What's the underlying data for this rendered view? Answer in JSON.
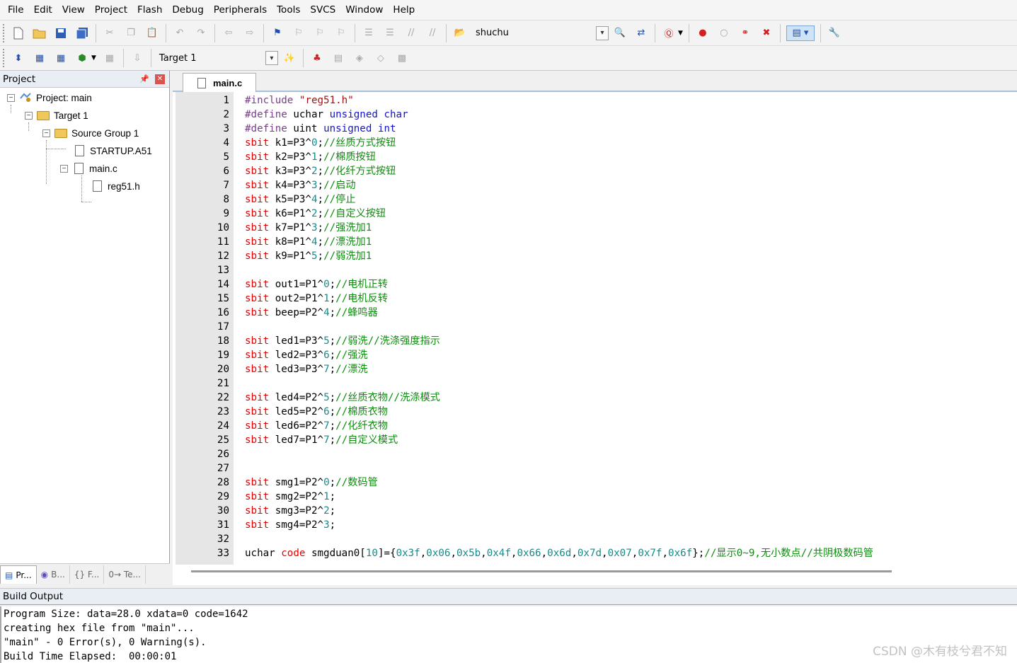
{
  "menu": [
    "File",
    "Edit",
    "View",
    "Project",
    "Flash",
    "Debug",
    "Peripherals",
    "Tools",
    "SVCS",
    "Window",
    "Help"
  ],
  "toolbar1": {
    "find_combo_value": "shuchu"
  },
  "toolbar2": {
    "target_combo_value": "Target 1"
  },
  "project_panel": {
    "title": "Project",
    "tree": [
      {
        "label": "Project: main",
        "level": 0,
        "kind": "project"
      },
      {
        "label": "Target 1",
        "level": 1,
        "kind": "target"
      },
      {
        "label": "Source Group 1",
        "level": 2,
        "kind": "folder"
      },
      {
        "label": "STARTUP.A51",
        "level": 3,
        "kind": "file"
      },
      {
        "label": "main.c",
        "level": 3,
        "kind": "file"
      },
      {
        "label": "reg51.h",
        "level": 4,
        "kind": "file"
      }
    ],
    "tabs": [
      "Pr...",
      "B...",
      "{} F...",
      "0→ Te..."
    ]
  },
  "editor": {
    "tab_label": "main.c",
    "lines": [
      [
        {
          "t": "#include ",
          "c": "pp"
        },
        {
          "t": "\"reg51.h\"",
          "c": "str"
        }
      ],
      [
        {
          "t": "#define ",
          "c": "pp"
        },
        {
          "t": "uchar ",
          "c": ""
        },
        {
          "t": "unsigned char",
          "c": "kw"
        }
      ],
      [
        {
          "t": "#define ",
          "c": "pp"
        },
        {
          "t": "uint ",
          "c": ""
        },
        {
          "t": "unsigned int",
          "c": "kw"
        }
      ],
      [
        {
          "t": "sbit ",
          "c": "red"
        },
        {
          "t": "k1=P3^",
          "c": ""
        },
        {
          "t": "0",
          "c": "num"
        },
        {
          "t": ";",
          "c": ""
        },
        {
          "t": "//丝质方式按钮",
          "c": "cm"
        }
      ],
      [
        {
          "t": "sbit ",
          "c": "red"
        },
        {
          "t": "k2=P3^",
          "c": ""
        },
        {
          "t": "1",
          "c": "num"
        },
        {
          "t": ";",
          "c": ""
        },
        {
          "t": "//棉质按钮",
          "c": "cm"
        }
      ],
      [
        {
          "t": "sbit ",
          "c": "red"
        },
        {
          "t": "k3=P3^",
          "c": ""
        },
        {
          "t": "2",
          "c": "num"
        },
        {
          "t": ";",
          "c": ""
        },
        {
          "t": "//化纤方式按钮",
          "c": "cm"
        }
      ],
      [
        {
          "t": "sbit ",
          "c": "red"
        },
        {
          "t": "k4=P3^",
          "c": ""
        },
        {
          "t": "3",
          "c": "num"
        },
        {
          "t": ";",
          "c": ""
        },
        {
          "t": "//启动",
          "c": "cm"
        }
      ],
      [
        {
          "t": "sbit ",
          "c": "red"
        },
        {
          "t": "k5=P3^",
          "c": ""
        },
        {
          "t": "4",
          "c": "num"
        },
        {
          "t": ";",
          "c": ""
        },
        {
          "t": "//停止",
          "c": "cm"
        }
      ],
      [
        {
          "t": "sbit ",
          "c": "red"
        },
        {
          "t": "k6=P1^",
          "c": ""
        },
        {
          "t": "2",
          "c": "num"
        },
        {
          "t": ";",
          "c": ""
        },
        {
          "t": "//自定义按钮",
          "c": "cm"
        }
      ],
      [
        {
          "t": "sbit ",
          "c": "red"
        },
        {
          "t": "k7=P1^",
          "c": ""
        },
        {
          "t": "3",
          "c": "num"
        },
        {
          "t": ";",
          "c": ""
        },
        {
          "t": "//强洗加1",
          "c": "cm"
        }
      ],
      [
        {
          "t": "sbit ",
          "c": "red"
        },
        {
          "t": "k8=P1^",
          "c": ""
        },
        {
          "t": "4",
          "c": "num"
        },
        {
          "t": ";",
          "c": ""
        },
        {
          "t": "//漂洗加1",
          "c": "cm"
        }
      ],
      [
        {
          "t": "sbit ",
          "c": "red"
        },
        {
          "t": "k9=P1^",
          "c": ""
        },
        {
          "t": "5",
          "c": "num"
        },
        {
          "t": ";",
          "c": ""
        },
        {
          "t": "//弱洗加1",
          "c": "cm"
        }
      ],
      [],
      [
        {
          "t": "sbit ",
          "c": "red"
        },
        {
          "t": "out1=P1^",
          "c": ""
        },
        {
          "t": "0",
          "c": "num"
        },
        {
          "t": ";",
          "c": ""
        },
        {
          "t": "//电机正转",
          "c": "cm"
        }
      ],
      [
        {
          "t": "sbit ",
          "c": "red"
        },
        {
          "t": "out2=P1^",
          "c": ""
        },
        {
          "t": "1",
          "c": "num"
        },
        {
          "t": ";",
          "c": ""
        },
        {
          "t": "//电机反转",
          "c": "cm"
        }
      ],
      [
        {
          "t": "sbit ",
          "c": "red"
        },
        {
          "t": "beep=P2^",
          "c": ""
        },
        {
          "t": "4",
          "c": "num"
        },
        {
          "t": ";",
          "c": ""
        },
        {
          "t": "//蜂鸣器",
          "c": "cm"
        }
      ],
      [],
      [
        {
          "t": "sbit ",
          "c": "red"
        },
        {
          "t": "led1=P3^",
          "c": ""
        },
        {
          "t": "5",
          "c": "num"
        },
        {
          "t": ";",
          "c": ""
        },
        {
          "t": "//弱洗//洗涤强度指示",
          "c": "cm"
        }
      ],
      [
        {
          "t": "sbit ",
          "c": "red"
        },
        {
          "t": "led2=P3^",
          "c": ""
        },
        {
          "t": "6",
          "c": "num"
        },
        {
          "t": ";",
          "c": ""
        },
        {
          "t": "//强洗",
          "c": "cm"
        }
      ],
      [
        {
          "t": "sbit ",
          "c": "red"
        },
        {
          "t": "led3=P3^",
          "c": ""
        },
        {
          "t": "7",
          "c": "num"
        },
        {
          "t": ";",
          "c": ""
        },
        {
          "t": "//漂洗",
          "c": "cm"
        }
      ],
      [],
      [
        {
          "t": "sbit ",
          "c": "red"
        },
        {
          "t": "led4=P2^",
          "c": ""
        },
        {
          "t": "5",
          "c": "num"
        },
        {
          "t": ";",
          "c": ""
        },
        {
          "t": "//丝质衣物//洗涤模式",
          "c": "cm"
        }
      ],
      [
        {
          "t": "sbit ",
          "c": "red"
        },
        {
          "t": "led5=P2^",
          "c": ""
        },
        {
          "t": "6",
          "c": "num"
        },
        {
          "t": ";",
          "c": ""
        },
        {
          "t": "//棉质衣物",
          "c": "cm"
        }
      ],
      [
        {
          "t": "sbit ",
          "c": "red"
        },
        {
          "t": "led6=P2^",
          "c": ""
        },
        {
          "t": "7",
          "c": "num"
        },
        {
          "t": ";",
          "c": ""
        },
        {
          "t": "//化纤衣物",
          "c": "cm"
        }
      ],
      [
        {
          "t": "sbit ",
          "c": "red"
        },
        {
          "t": "led7=P1^",
          "c": ""
        },
        {
          "t": "7",
          "c": "num"
        },
        {
          "t": ";",
          "c": ""
        },
        {
          "t": "//自定义模式",
          "c": "cm"
        }
      ],
      [],
      [],
      [
        {
          "t": "sbit ",
          "c": "red"
        },
        {
          "t": "smg1=P2^",
          "c": ""
        },
        {
          "t": "0",
          "c": "num"
        },
        {
          "t": ";",
          "c": ""
        },
        {
          "t": "//数码管",
          "c": "cm"
        }
      ],
      [
        {
          "t": "sbit ",
          "c": "red"
        },
        {
          "t": "smg2=P2^",
          "c": ""
        },
        {
          "t": "1",
          "c": "num"
        },
        {
          "t": ";",
          "c": ""
        }
      ],
      [
        {
          "t": "sbit ",
          "c": "red"
        },
        {
          "t": "smg3=P2^",
          "c": ""
        },
        {
          "t": "2",
          "c": "num"
        },
        {
          "t": ";",
          "c": ""
        }
      ],
      [
        {
          "t": "sbit ",
          "c": "red"
        },
        {
          "t": "smg4=P2^",
          "c": ""
        },
        {
          "t": "3",
          "c": "num"
        },
        {
          "t": ";",
          "c": ""
        }
      ],
      [],
      [
        {
          "t": "uchar ",
          "c": ""
        },
        {
          "t": "code ",
          "c": "red"
        },
        {
          "t": "smgduan0[",
          "c": ""
        },
        {
          "t": "10",
          "c": "num"
        },
        {
          "t": "]={",
          "c": ""
        },
        {
          "t": "0x3f",
          "c": "num"
        },
        {
          "t": ",",
          "c": ""
        },
        {
          "t": "0x06",
          "c": "num"
        },
        {
          "t": ",",
          "c": ""
        },
        {
          "t": "0x5b",
          "c": "num"
        },
        {
          "t": ",",
          "c": ""
        },
        {
          "t": "0x4f",
          "c": "num"
        },
        {
          "t": ",",
          "c": ""
        },
        {
          "t": "0x66",
          "c": "num"
        },
        {
          "t": ",",
          "c": ""
        },
        {
          "t": "0x6d",
          "c": "num"
        },
        {
          "t": ",",
          "c": ""
        },
        {
          "t": "0x7d",
          "c": "num"
        },
        {
          "t": ",",
          "c": ""
        },
        {
          "t": "0x07",
          "c": "num"
        },
        {
          "t": ",",
          "c": ""
        },
        {
          "t": "0x7f",
          "c": "num"
        },
        {
          "t": ",",
          "c": ""
        },
        {
          "t": "0x6f",
          "c": "num"
        },
        {
          "t": "};",
          "c": ""
        },
        {
          "t": "//显示0~9,无小数点//共阴极数码管",
          "c": "cm"
        }
      ]
    ]
  },
  "build_output": {
    "title": "Build Output",
    "lines": [
      "Program Size: data=28.0 xdata=0 code=1642",
      "creating hex file from \"main\"...",
      "\"main\" - 0 Error(s), 0 Warning(s).",
      "Build Time Elapsed:  00:00:01"
    ]
  },
  "watermark": "CSDN @木有枝兮君不知",
  "colors": {
    "preprocessor": "#7a3d8a",
    "string": "#a01010",
    "keyword": "#1515c8",
    "sbit_keyword": "#e60000",
    "comment": "#0e8c0e",
    "number": "#1a8a8a"
  }
}
